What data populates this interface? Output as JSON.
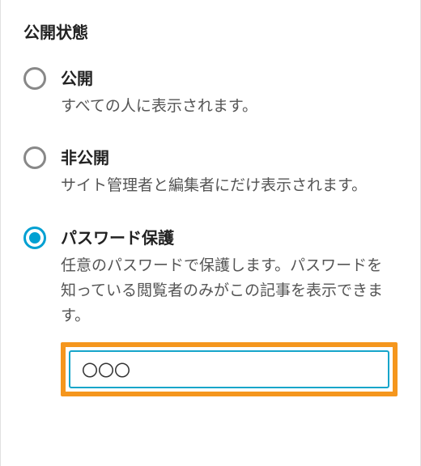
{
  "section": {
    "title": "公開状態"
  },
  "options": {
    "public": {
      "title": "公開",
      "description": "すべての人に表示されます。",
      "selected": false
    },
    "private": {
      "title": "非公開",
      "description": "サイト管理者と編集者にだけ表示されます。",
      "selected": false
    },
    "password": {
      "title": "パスワード保護",
      "description": "任意のパスワードで保護します。パスワードを知っている閲覧者のみがこの記事を表示できます。",
      "selected": true,
      "input_value": "〇〇〇"
    }
  }
}
